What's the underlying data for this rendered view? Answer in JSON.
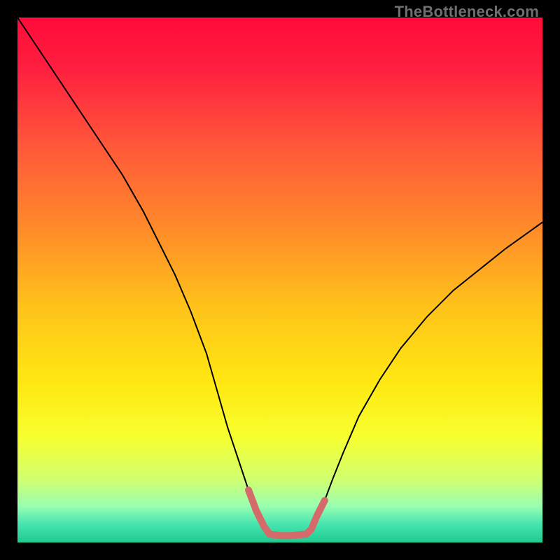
{
  "watermark": {
    "text": "TheBottleneck.com"
  },
  "chart_data": {
    "type": "line",
    "title": "",
    "xlabel": "",
    "ylabel": "",
    "xlim": [
      0,
      100
    ],
    "ylim": [
      0,
      100
    ],
    "grid": false,
    "legend": false,
    "gradient_stops": [
      {
        "offset": 0.0,
        "color": "#ff0b3a"
      },
      {
        "offset": 0.1,
        "color": "#ff2040"
      },
      {
        "offset": 0.24,
        "color": "#ff563a"
      },
      {
        "offset": 0.4,
        "color": "#ff8a2a"
      },
      {
        "offset": 0.55,
        "color": "#ffc21a"
      },
      {
        "offset": 0.7,
        "color": "#ffe912"
      },
      {
        "offset": 0.8,
        "color": "#f7ff30"
      },
      {
        "offset": 0.88,
        "color": "#d0ff70"
      },
      {
        "offset": 0.93,
        "color": "#9affb0"
      },
      {
        "offset": 0.965,
        "color": "#47e5b0"
      },
      {
        "offset": 1.0,
        "color": "#1fc98f"
      }
    ],
    "series": [
      {
        "name": "bottleneck-curve",
        "stroke": "#000000",
        "stroke_width": 2,
        "x": [
          0,
          4,
          8,
          12,
          16,
          20,
          24,
          27,
          30,
          33,
          36,
          38,
          40,
          42,
          44,
          45.5,
          47,
          48,
          55,
          56,
          57,
          58.5,
          60,
          62,
          65,
          69,
          73,
          78,
          83,
          88,
          93,
          100
        ],
        "y": [
          100,
          94,
          88,
          82,
          76,
          70,
          63,
          57,
          51,
          44,
          36,
          29,
          22,
          16,
          10,
          6,
          3,
          1.6,
          1.6,
          2.6,
          5,
          8,
          12,
          17,
          24,
          31,
          37,
          43,
          48,
          52,
          56,
          61
        ]
      },
      {
        "name": "sweet-spot-band",
        "stroke": "#d46a6a",
        "stroke_width": 10,
        "stroke_linecap": "round",
        "x": [
          44,
          45.5,
          47,
          48,
          50,
          52,
          55,
          56,
          57,
          58.5
        ],
        "y": [
          10,
          6,
          3,
          1.6,
          1.3,
          1.3,
          1.6,
          2.6,
          5,
          8
        ]
      }
    ]
  }
}
